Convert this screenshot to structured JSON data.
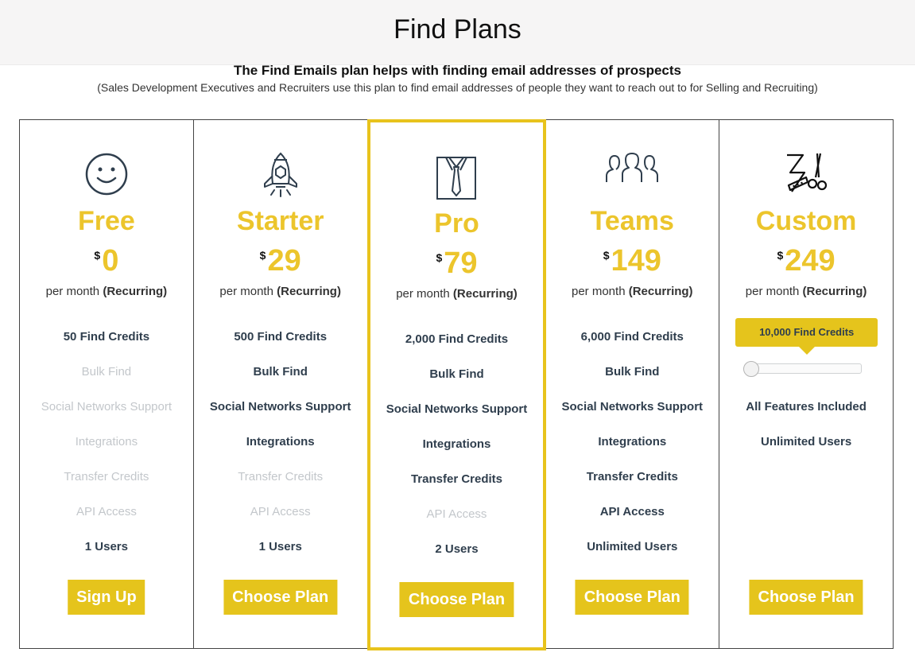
{
  "page": {
    "title": "Find Plans",
    "subtitle": "The Find Emails plan helps with finding email addresses of prospects",
    "description": "(Sales Development Executives and Recruiters use this plan to find email addresses of people they want to reach out to for Selling and Recruiting)"
  },
  "common": {
    "currency": "$",
    "per_month": "per month",
    "recurring": "(Recurring)"
  },
  "colors": {
    "accent": "#e5c41c",
    "plan_name": "#ecc52c",
    "text_dark": "#2f3e4d",
    "text_disabled": "#c3c7cb",
    "featured_border": "#e8c31c"
  },
  "plans": [
    {
      "name": "Free",
      "icon": "smiley-face-icon",
      "price": "0",
      "cta": "Sign Up",
      "features": [
        {
          "label": "50 Find Credits",
          "enabled": true
        },
        {
          "label": "Bulk Find",
          "enabled": false
        },
        {
          "label": "Social Networks Support",
          "enabled": false
        },
        {
          "label": "Integrations",
          "enabled": false
        },
        {
          "label": "Transfer Credits",
          "enabled": false
        },
        {
          "label": "API Access",
          "enabled": false
        },
        {
          "label": "1 Users",
          "enabled": true
        }
      ]
    },
    {
      "name": "Starter",
      "icon": "rocket-icon",
      "price": "29",
      "cta": "Choose Plan",
      "features": [
        {
          "label": "500 Find Credits",
          "enabled": true
        },
        {
          "label": "Bulk Find",
          "enabled": true
        },
        {
          "label": "Social Networks Support",
          "enabled": true
        },
        {
          "label": "Integrations",
          "enabled": true
        },
        {
          "label": "Transfer Credits",
          "enabled": false
        },
        {
          "label": "API Access",
          "enabled": false
        },
        {
          "label": "1 Users",
          "enabled": true
        }
      ]
    },
    {
      "name": "Pro",
      "icon": "shirt-tie-icon",
      "price": "79",
      "cta": "Choose Plan",
      "featured": true,
      "features": [
        {
          "label": "2,000 Find Credits",
          "enabled": true
        },
        {
          "label": "Bulk Find",
          "enabled": true
        },
        {
          "label": "Social Networks Support",
          "enabled": true
        },
        {
          "label": "Integrations",
          "enabled": true
        },
        {
          "label": "Transfer Credits",
          "enabled": true
        },
        {
          "label": "API Access",
          "enabled": false
        },
        {
          "label": "2 Users",
          "enabled": true
        }
      ]
    },
    {
      "name": "Teams",
      "icon": "team-people-icon",
      "price": "149",
      "cta": "Choose Plan",
      "features": [
        {
          "label": "6,000 Find Credits",
          "enabled": true
        },
        {
          "label": "Bulk Find",
          "enabled": true
        },
        {
          "label": "Social Networks Support",
          "enabled": true
        },
        {
          "label": "Integrations",
          "enabled": true
        },
        {
          "label": "Transfer Credits",
          "enabled": true
        },
        {
          "label": "API Access",
          "enabled": true
        },
        {
          "label": "Unlimited Users",
          "enabled": true
        }
      ]
    },
    {
      "name": "Custom",
      "icon": "tailor-tools-icon",
      "price": "249",
      "cta": "Choose Plan",
      "credits_tooltip": "10,000 Find Credits",
      "slider": {
        "min": 0,
        "max": 100,
        "value": 0
      },
      "features": [
        {
          "label": "All Features Included",
          "enabled": true
        },
        {
          "label": "Unlimited Users",
          "enabled": true
        }
      ]
    }
  ]
}
